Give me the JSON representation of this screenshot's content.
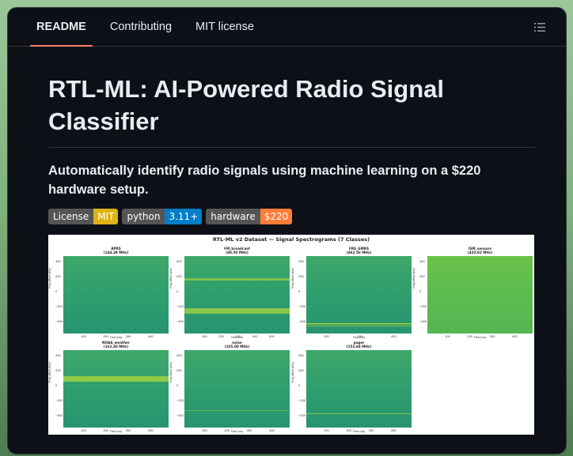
{
  "tabs": [
    {
      "label": "README",
      "active": true
    },
    {
      "label": "Contributing",
      "active": false
    },
    {
      "label": "MIT license",
      "active": false
    }
  ],
  "toc_icon": "list-unordered-icon",
  "readme": {
    "title": "RTL-ML: AI-Powered Radio Signal Classifier",
    "subtitle": "Automatically identify radio signals using machine learning on a $220 hardware setup.",
    "badges": [
      {
        "key": "License",
        "value": "MIT",
        "color": "#dfb317"
      },
      {
        "key": "python",
        "value": "3.11+",
        "color": "#007ec6"
      },
      {
        "key": "hardware",
        "value": "$220",
        "color": "#fe7d37"
      }
    ]
  },
  "figure": {
    "title": "RTL-ML v2 Dataset — Signal Spectrograms (7 Classes)",
    "ylabel": "Freq offset (kHz)",
    "xlabel": "Time (ms)",
    "yticks": [
      "400",
      "200",
      "0",
      "−200",
      "−400"
    ],
    "panels": [
      {
        "name": "APRS",
        "freq": "(144.39 MHz)",
        "xticks": [
          "100",
          "200",
          "300",
          "400"
        ]
      },
      {
        "name": "FM_broadcast",
        "freq": "(88.50 MHz)",
        "xticks": [
          "100",
          "200",
          "300",
          "400",
          "500"
        ]
      },
      {
        "name": "FRS_GMRS",
        "freq": "(462.56 MHz)",
        "xticks": [
          "200",
          "300",
          "400"
        ]
      },
      {
        "name": "ISM_sensors",
        "freq": "(433.92 MHz)",
        "xticks": [
          "100",
          "200",
          "300",
          "400"
        ]
      },
      {
        "name": "NOAA_weather",
        "freq": "(162.40 MHz)",
        "xticks": [
          "100",
          "200",
          "300",
          "400"
        ]
      },
      {
        "name": "noise",
        "freq": "(105.00 MHz)",
        "xticks": [
          "100",
          "200",
          "300",
          "400"
        ]
      },
      {
        "name": "pager",
        "freq": "(152.84 MHz)",
        "xticks": [
          "100",
          "200",
          "300",
          "400"
        ]
      }
    ],
    "colors": {
      "background": "#2a9a6e",
      "signal": "#b5d934",
      "accent": "#f78166"
    }
  }
}
